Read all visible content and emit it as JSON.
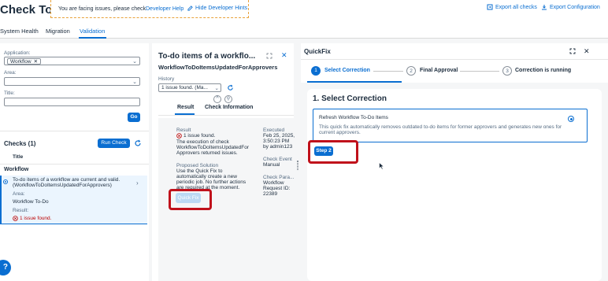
{
  "header": {
    "app_title": "Check Tool",
    "hint_text": "You are facing issues, please check",
    "hint_link": "Developer Help",
    "hint_hide": "Hide Developer Hints",
    "export_all": "Export all checks",
    "export_config": "Export Configuration"
  },
  "tabs": [
    {
      "label": "System Health"
    },
    {
      "label": "Migration"
    },
    {
      "label": "Validation"
    }
  ],
  "filters": {
    "application_label": "Application:",
    "application_token": "Workflow",
    "area_label": "Area:",
    "title_label": "Title:",
    "go_label": "Go"
  },
  "checks": {
    "header": "Checks (1)",
    "run_check": "Run Check",
    "column_title": "Title",
    "group": "Workflow",
    "item": {
      "title_line1": "To-do items of a workflow are current and valid.",
      "title_line2": "(WorkflowToDoItemsUpdatedForApprovers)",
      "area_label": "Area:",
      "area_value": "Workflow To-Do",
      "result_label": "Result:",
      "result_value": "1 issue found."
    }
  },
  "detail": {
    "title": "To-do items of a workflo...",
    "subtitle": "WorkflowToDoItemsUpdatedForApprovers",
    "history_label": "History",
    "history_value": "1 issue found. (Ma...",
    "tab_result": "Result",
    "tab_check_info": "Check Information",
    "result_label": "Result",
    "result_issue": "1 issue found.",
    "result_text": [
      "The execution of check",
      "WorkflowToDoItemsUpdatedFor",
      "Approvers returned issues."
    ],
    "proposed_label": "Proposed Solution",
    "proposed_text": [
      "Use the Quick Fix to",
      "automatically create a new",
      "periodic job. No further actions",
      "are required at the moment."
    ],
    "quick_fix_label": "Quick Fix",
    "executed_label": "Executed",
    "executed_value": [
      "Feb 25, 2025,",
      "3:50:23 PM",
      "by admin123"
    ],
    "check_event_label": "Check Event",
    "check_event_value": "Manual",
    "check_params_label": "Check Para...",
    "check_params_value": [
      "Workflow",
      "Request ID:",
      "22389"
    ]
  },
  "quickfix": {
    "title": "QuickFix",
    "steps": [
      {
        "num": "1",
        "label": "Select Correction"
      },
      {
        "num": "2",
        "label": "Final Approval"
      },
      {
        "num": "3",
        "label": "Correction is running"
      }
    ],
    "section_title": "1. Select Correction",
    "option_title": "Refresh Workflow To-Do Items",
    "option_desc": "This quick fix automatically removes outdated to-do items for former approvers and generates new ones for current approvers.",
    "step2_button": "Step 2"
  },
  "colors": {
    "accent": "#0a6ed1",
    "error": "#bb0000",
    "highlight": "#c0111b"
  }
}
